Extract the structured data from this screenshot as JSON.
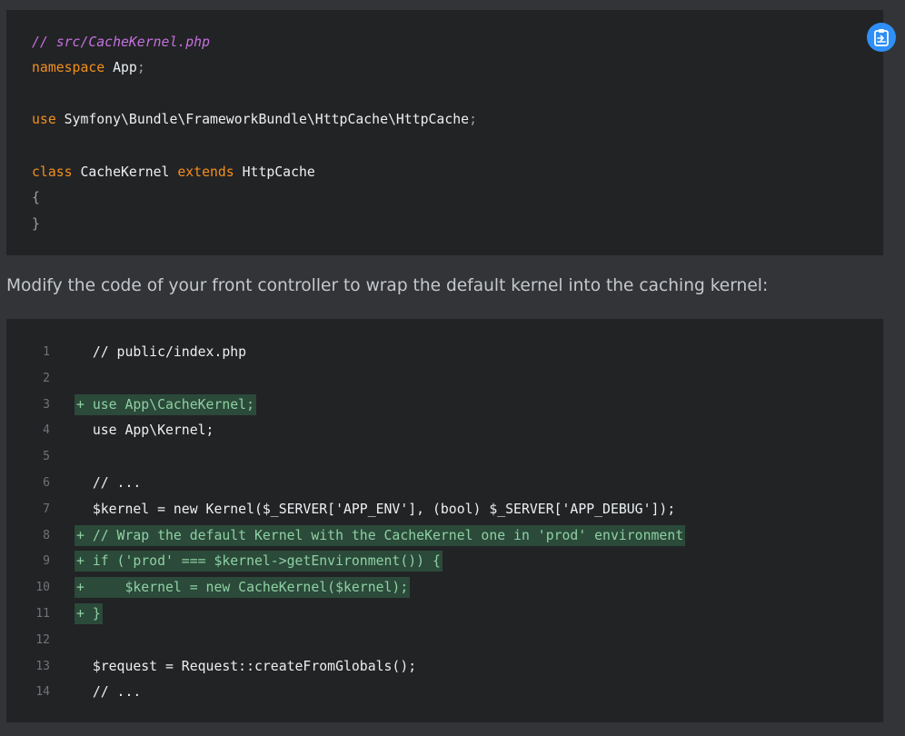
{
  "top_code": {
    "comment": "// src/CacheKernel.php",
    "kw_namespace": "namespace",
    "namespace_name": " App",
    "semicolon": ";",
    "kw_use": "use",
    "use_path": " Symfony\\Bundle\\FrameworkBundle\\HttpCache\\HttpCache",
    "kw_class": "class",
    "class_name": " CacheKernel ",
    "kw_extends": "extends",
    "parent_class": " HttpCache",
    "brace_open": "{",
    "brace_close": "}",
    "copy_icon": "clipboard-icon",
    "accent": "#2f8ff7"
  },
  "prose": "Modify the code of your front controller to wrap the default kernel into the caching kernel:",
  "diff": {
    "lines": [
      {
        "n": "1",
        "text": "  // public/index.php",
        "added": false
      },
      {
        "n": "2",
        "text": "",
        "added": false
      },
      {
        "n": "3",
        "text": "+ use App\\CacheKernel;",
        "added": true
      },
      {
        "n": "4",
        "text": "  use App\\Kernel;",
        "added": false
      },
      {
        "n": "5",
        "text": "",
        "added": false
      },
      {
        "n": "6",
        "text": "  // ...",
        "added": false
      },
      {
        "n": "7",
        "text": "  $kernel = new Kernel($_SERVER['APP_ENV'], (bool) $_SERVER['APP_DEBUG']);",
        "added": false
      },
      {
        "n": "8",
        "text": "+ // Wrap the default Kernel with the CacheKernel one in 'prod' environment",
        "added": true
      },
      {
        "n": "9",
        "text": "+ if ('prod' === $kernel->getEnvironment()) {",
        "added": true
      },
      {
        "n": "10",
        "text": "+     $kernel = new CacheKernel($kernel);",
        "added": true
      },
      {
        "n": "11",
        "text": "+ }",
        "added": true
      },
      {
        "n": "12",
        "text": "",
        "added": false
      },
      {
        "n": "13",
        "text": "  $request = Request::createFromGlobals();",
        "added": false
      },
      {
        "n": "14",
        "text": "  // ...",
        "added": false
      }
    ]
  }
}
